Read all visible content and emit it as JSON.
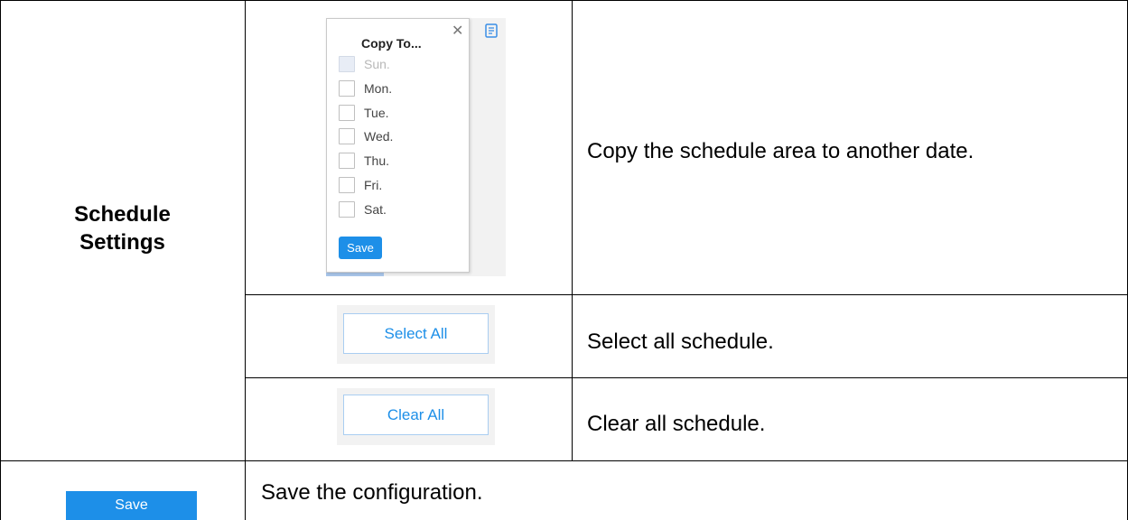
{
  "table": {
    "row_header": "Schedule Settings",
    "rows": [
      {
        "description": "Copy the schedule area to another date."
      },
      {
        "description": "Select all schedule."
      },
      {
        "description": "Clear all schedule."
      },
      {
        "description": "Save the configuration."
      }
    ]
  },
  "copy_popup": {
    "title": "Copy To...",
    "close_icon": "close-icon",
    "days": [
      {
        "label": "Sun.",
        "disabled": true
      },
      {
        "label": "Mon."
      },
      {
        "label": "Tue."
      },
      {
        "label": "Wed."
      },
      {
        "label": "Thu."
      },
      {
        "label": "Fri."
      },
      {
        "label": "Sat."
      }
    ],
    "save_label": "Save",
    "copy_icon": "copy-icon"
  },
  "buttons": {
    "select_all": "Select All",
    "clear_all": "Clear All",
    "save": "Save"
  },
  "colors": {
    "accent": "#1d8fe8",
    "outline": "#a9cdf1",
    "image_background": "#f2f2f2"
  }
}
